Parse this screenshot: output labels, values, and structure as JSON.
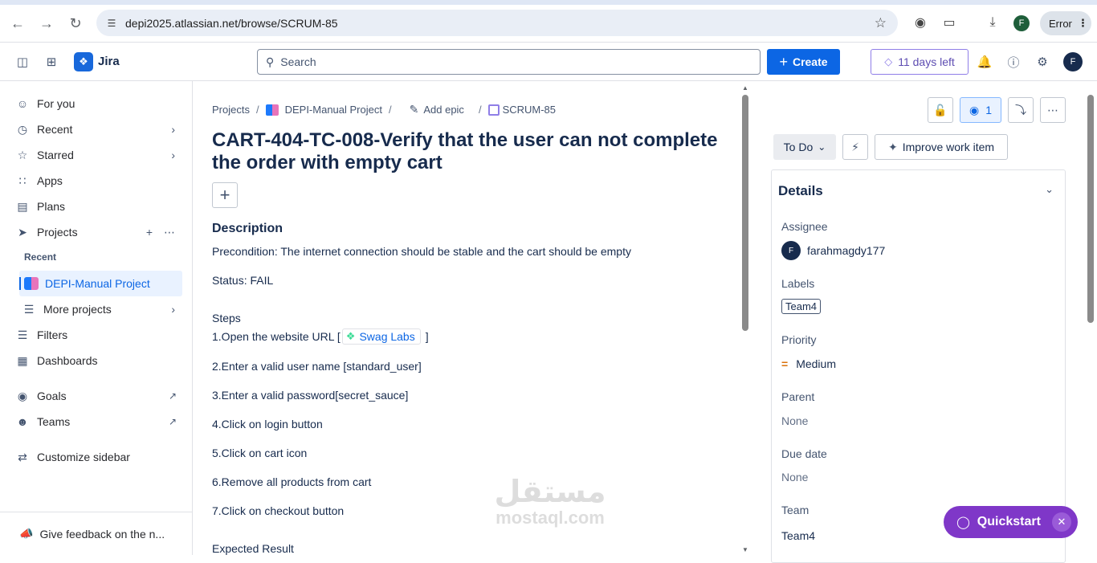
{
  "browser": {
    "url": "depi2025.atlassian.net/browse/SCRUM-85",
    "profile_initial": "F",
    "error_label": "Error"
  },
  "topbar": {
    "app_name": "Jira",
    "search_placeholder": "Search",
    "create_label": "Create",
    "trial_label": "11 days left",
    "avatar_initial": "F"
  },
  "sidebar": {
    "for_you": "For you",
    "recent": "Recent",
    "starred": "Starred",
    "apps": "Apps",
    "plans": "Plans",
    "projects": "Projects",
    "recent_section": "Recent",
    "active_project": "DEPI-Manual Project",
    "more_projects": "More projects",
    "filters": "Filters",
    "dashboards": "Dashboards",
    "goals": "Goals",
    "teams": "Teams",
    "customize": "Customize sidebar",
    "feedback": "Give feedback on the n..."
  },
  "breadcrumb": {
    "projects": "Projects",
    "project": "DEPI-Manual Project",
    "add_epic": "Add epic",
    "issue_key": "SCRUM-85"
  },
  "issue": {
    "title": "CART-404-TC-008-Verify that the user can not complete the order with empty cart",
    "description_heading": "Description",
    "precondition": "Precondition: The internet connection should be stable and the cart should be empty",
    "status_text": "Status: FAIL",
    "steps_heading": "Steps",
    "step1_prefix": "1.Open the website URL [",
    "step1_link": "Swag Labs",
    "step1_suffix": "]",
    "step2": "2.Enter a valid user name [standard_user]",
    "step3": "3.Enter a valid password[secret_sauce]",
    "step4": "4.Click on login button",
    "step5": "5.Click on cart icon",
    "step6": "6.Remove all products from cart",
    "step7": "7.Click on checkout button",
    "expected_heading": "Expected Result"
  },
  "watermark": {
    "arabic": "مستقل",
    "latin": "mostaql.com"
  },
  "panel": {
    "watchers": "1",
    "status": "To Do",
    "improve": "Improve work item",
    "details_heading": "Details",
    "assignee_label": "Assignee",
    "assignee_initial": "F",
    "assignee": "farahmagdy177",
    "labels_label": "Labels",
    "label_value": "Team4",
    "priority_label": "Priority",
    "priority_value": "Medium",
    "parent_label": "Parent",
    "parent_value": "None",
    "due_label": "Due date",
    "due_value": "None",
    "team_label": "Team",
    "team_value": "Team4"
  },
  "quickstart": {
    "label": "Quickstart"
  },
  "colors": {
    "primary": "#0c66e4",
    "quickstart": "#7f37c8",
    "trial_border": "#8f7ee7",
    "priority_medium": "#d97008"
  }
}
